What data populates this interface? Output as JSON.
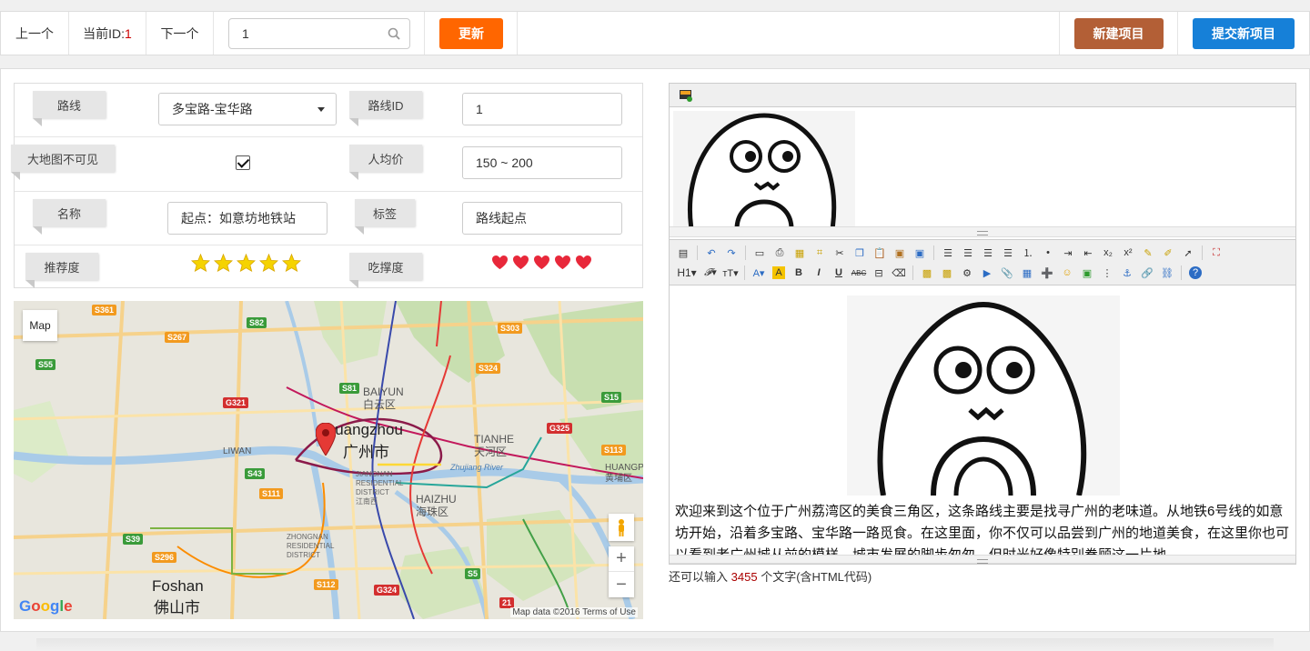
{
  "topbar": {
    "prev_label": "上一个",
    "current_id_label": "当前ID:",
    "current_id_value": "1",
    "next_label": "下一个",
    "search_value": "1",
    "update_label": "更新",
    "new_project_label": "新建项目",
    "submit_project_label": "提交新项目"
  },
  "form": {
    "route_label": "路线",
    "route_value": "多宝路-宝华路",
    "route_id_label": "路线ID",
    "route_id_value": "1",
    "map_invisible_label": "大地图不可见",
    "map_invisible_checked": true,
    "avg_price_label": "人均价",
    "avg_price_value": "150 ~ 200",
    "name_label": "名称",
    "name_value": "起点：如意坊地铁站",
    "tag_label": "标签",
    "tag_value": "路线起点",
    "recommend_label": "推荐度",
    "recommend_stars": 5,
    "fullness_label": "吃撑度",
    "fullness_hearts": 5
  },
  "map": {
    "type_button": "Map",
    "city_en": "Guangzhou",
    "city_cn": "广州市",
    "foshan_en": "Foshan",
    "foshan_cn": "佛山市",
    "baiyun_en": "BAIYUN",
    "baiyun_cn": "白云区",
    "tianhe_en": "TIANHE",
    "tianhe_cn": "天河区",
    "haizhu_en": "HAIZHU",
    "haizhu_cn": "海珠区",
    "liwan_en": "LIWAN",
    "huangpu_en": "HUANGP",
    "huangpu_cn": "黄埔区",
    "jiangnan_en": "JIANGNAN RESIDENTIAL DISTRICT",
    "jiangnan_cn": "江南西",
    "zhongnan_en": "ZHONGNAN RESIDENTIAL DISTRICT",
    "pearl_river": "Zhujiang River",
    "roads": [
      "S361",
      "S82",
      "S267",
      "S303",
      "S55",
      "S81",
      "S324",
      "S15",
      "G321",
      "S113",
      "G325",
      "S43",
      "S39",
      "S111",
      "S296",
      "S112",
      "G324",
      "S5",
      "21"
    ],
    "zoom_in": "+",
    "zoom_out": "−",
    "google": "Google",
    "credit": "Map data ©2016  Terms of Use"
  },
  "editor": {
    "toolbar_row1": [
      "source",
      "undo",
      "redo",
      "preview",
      "print",
      "template",
      "code",
      "cut",
      "copy",
      "paste",
      "paste-text",
      "paste-word",
      "align-left",
      "align-center",
      "align-right",
      "justify",
      "ordered-list",
      "unordered-list",
      "indent",
      "outdent",
      "subscript",
      "superscript",
      "clear",
      "select-all",
      "fullscreen"
    ],
    "heading_button": "H1",
    "content_text": "欢迎来到这个位于广州荔湾区的美食三角区，这条路线主要是找寻广州的老味道。从地铁6号线的如意坊开始，沿着多宝路、宝华路一路觅食。在这里面，你不仅可以品尝到广州的地道美食，在这里你也可以看到老广州城从前的模样，城市发展的脚步匆匆，但时光好像特别眷顾这一片地",
    "counter_prefix": "还可以输入",
    "counter_value": "3455",
    "counter_suffix": "个文字(含HTML代码)"
  },
  "colors": {
    "update_btn": "#ff6600",
    "new_btn": "#b35f36",
    "submit_btn": "#1680d8",
    "star": "#f5d300",
    "heart": "#e8283a"
  }
}
